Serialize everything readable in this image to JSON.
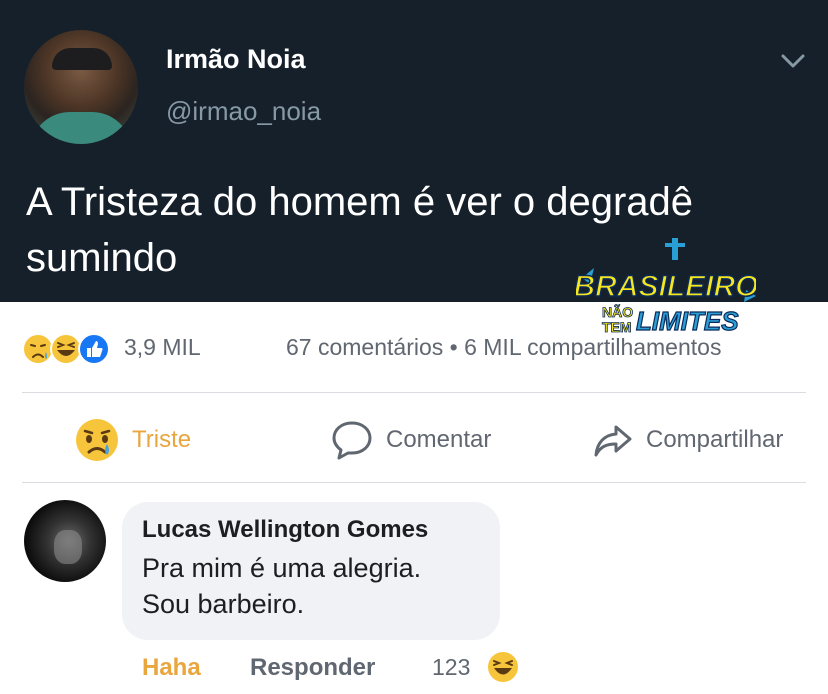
{
  "tweet": {
    "name": "Irmão Noia",
    "handle": "@irmao_noia",
    "text": "A Tristeza do homem é ver o degradê sumindo"
  },
  "watermark": {
    "line1": "BRASILEIRO",
    "line2a": "NÃO",
    "line2b": "TEM",
    "line3": "LIMITES"
  },
  "post": {
    "reaction_count": "3,9 MIL",
    "stats": "67 comentários • 6 MIL compartilhamentos",
    "reaction_icons": [
      "sad-icon",
      "haha-icon",
      "like-icon"
    ]
  },
  "actions": {
    "triste_label": "Triste",
    "comment_label": "Comentar",
    "share_label": "Compartilhar"
  },
  "comment": {
    "author": "Lucas Wellington Gomes",
    "text_line1": "Pra mim é uma alegria.",
    "text_line2": "Sou barbeiro.",
    "reaction_label": "Haha",
    "reply_label": "Responder",
    "reaction_count": "123"
  },
  "colors": {
    "tweet_bg": "#15202b",
    "reaction_accent": "#e9a53e",
    "text_gray": "#606770",
    "like_blue": "#1877f2",
    "watermark_yellow": "#f5e61e",
    "watermark_blue": "#2a9fd6"
  }
}
